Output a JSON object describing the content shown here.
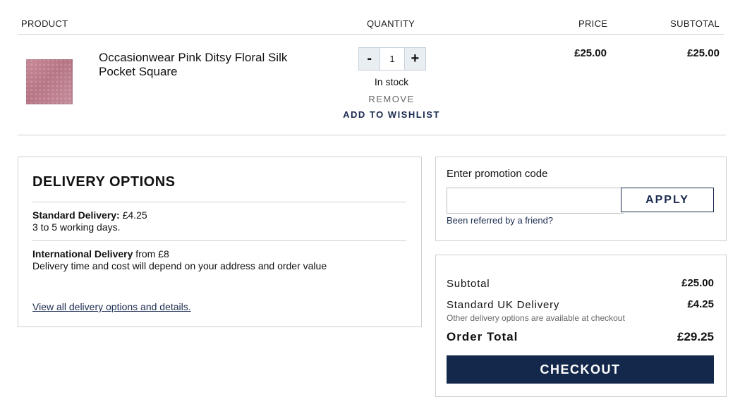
{
  "table_header": {
    "product": "PRODUCT",
    "quantity": "QUANTITY",
    "price": "PRICE",
    "subtotal": "SUBTOTAL"
  },
  "item": {
    "name": "Occasionwear Pink Ditsy Floral Silk Pocket Square",
    "quantity": "1",
    "minus": "-",
    "plus": "+",
    "stock": "In stock",
    "remove": "REMOVE",
    "wishlist": "ADD TO WISHLIST",
    "price": "£25.00",
    "subtotal": "£25.00",
    "thumbnail_color": "#c08393"
  },
  "delivery": {
    "title": "DELIVERY OPTIONS",
    "standard_label": "Standard Delivery:",
    "standard_price": " £4.25",
    "standard_time": "3 to 5 working days.",
    "international_label": "International Delivery",
    "international_price": " from £8",
    "international_note": "Delivery time and cost will depend on your address and order value",
    "link": "View all delivery options and details."
  },
  "promo": {
    "label": "Enter promotion code",
    "input_value": "",
    "apply": "APPLY",
    "referred": "Been referred by a friend?"
  },
  "summary": {
    "subtotal_label": "Subtotal",
    "subtotal_value": "£25.00",
    "shipping_label": "Standard UK Delivery",
    "shipping_value": "£4.25",
    "shipping_note": "Other delivery options are available at checkout",
    "total_label": "Order Total",
    "total_value": "£29.25",
    "checkout": "CHECKOUT"
  },
  "colors": {
    "navy": "#14284b",
    "border": "#cfcfcf"
  }
}
